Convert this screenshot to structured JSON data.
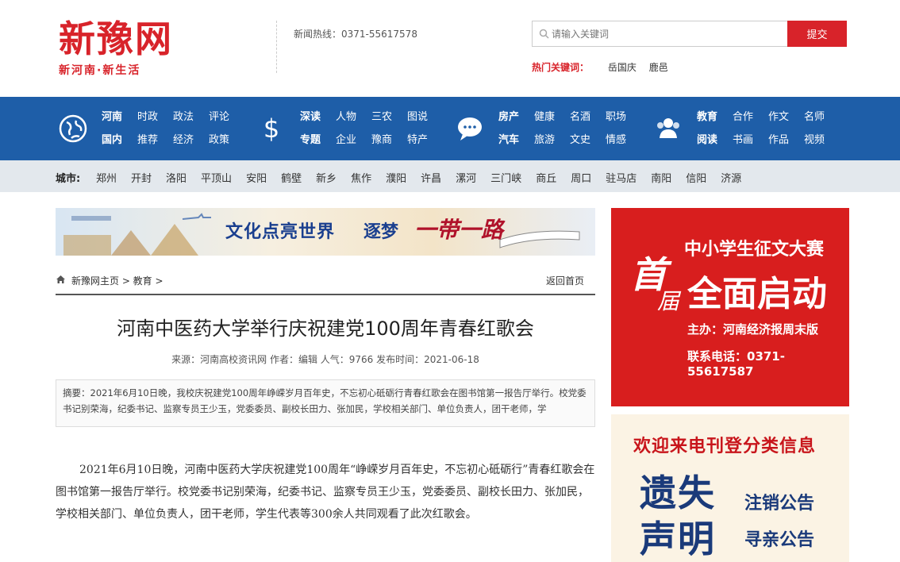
{
  "header": {
    "logo_main": "新豫网",
    "logo_sub": "新河南·新生活",
    "hotline": "新闻热线：0371-55617578",
    "search_placeholder": "请输入关键词",
    "search_button": "提交",
    "hot_keywords_label": "热门关键词：",
    "hot_keywords": [
      "岳国庆",
      "鹿邑"
    ]
  },
  "nav": {
    "groups": [
      {
        "icon": "globe-icon",
        "col1": [
          "河南",
          "国内"
        ],
        "col2": [
          "时政",
          "推荐"
        ],
        "col3": [
          "政法",
          "经济"
        ],
        "col4": [
          "评论",
          "政策"
        ]
      },
      {
        "icon": "dollar-icon",
        "col1": [
          "深读",
          "专题"
        ],
        "col2": [
          "人物",
          "企业"
        ],
        "col3": [
          "三农",
          "豫商"
        ],
        "col4": [
          "图说",
          "特产"
        ]
      },
      {
        "icon": "chat-bubble-icon",
        "col1": [
          "房产",
          "汽车"
        ],
        "col2": [
          "健康",
          "旅游"
        ],
        "col3": [
          "名酒",
          "文史"
        ],
        "col4": [
          "职场",
          "情感"
        ]
      },
      {
        "icon": "users-icon",
        "col1": [
          "教育",
          "阅读"
        ],
        "col2": [
          "合作",
          "书画"
        ],
        "col3": [
          "作文",
          "作品"
        ],
        "col4": [
          "名师",
          "视频"
        ]
      }
    ]
  },
  "city_bar": {
    "label": "城市:",
    "cities": [
      "郑州",
      "开封",
      "洛阳",
      "平顶山",
      "安阳",
      "鹤壁",
      "新乡",
      "焦作",
      "濮阳",
      "许昌",
      "漯河",
      "三门峡",
      "商丘",
      "周口",
      "驻马店",
      "南阳",
      "信阳",
      "济源"
    ]
  },
  "banner": {
    "text1": "文化点亮世界",
    "text2": "逐梦",
    "text3": "一带一路"
  },
  "breadcrumb": {
    "path": "新豫网主页 > 教育 >",
    "back": "返回首页"
  },
  "article": {
    "title": "河南中医药大学举行庆祝建党100周年青春红歌会",
    "meta": "来源：河南高校资讯网 作者：编辑 人气：9766 发布时间：2021-06-18",
    "summary": "摘要：2021年6月10日晚，我校庆祝建党100周年峥嵘岁月百年史，不忘初心砥砺行青春红歌会在图书馆第一报告厅举行。校党委书记别荣海，纪委书记、监察专员王少玉，党委委员、副校长田力、张加民，学校相关部门、单位负责人，团干老师，学",
    "body": "2021年6月10日晚，河南中医药大学庆祝建党100周年“峥嵘岁月百年史，不忘初心砥砺行”青春红歌会在图书馆第一报告厅举行。校党委书记别荣海，纪委书记、监察专员王少玉，党委委员、副校长田力、张加民，学校相关部门、单位负责人，团干老师，学生代表等300余人共同观看了此次红歌会。"
  },
  "ads": {
    "ad1": {
      "brush1": "首",
      "brush2": "届",
      "line1": "中小学生征文大赛",
      "line2": "全面启动",
      "line3": "主办：河南经济报周末版",
      "line4": "联系电话：0371-55617587"
    },
    "ad2": {
      "heading": "欢迎来电刊登分类信息",
      "big": "遗失声明",
      "item1": "注销公告",
      "item2": "寻亲公告"
    }
  },
  "colors": {
    "brand_red": "#d8232a",
    "nav_blue": "#1e5ea8",
    "city_bar": "#e3e8ed"
  }
}
